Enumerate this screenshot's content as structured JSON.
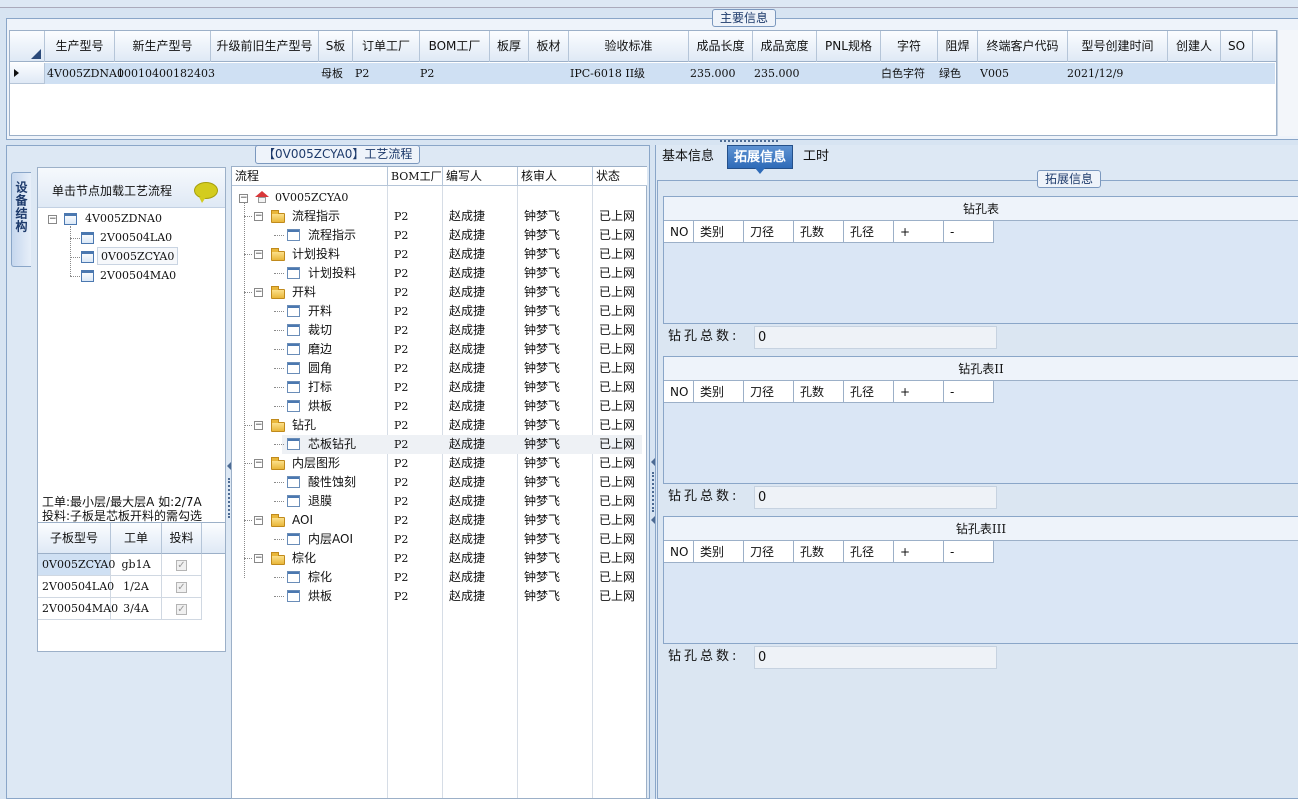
{
  "main_info": {
    "title": "主要信息",
    "columns": [
      "生产型号",
      "新生产型号",
      "升级前旧生产型号",
      "S板",
      "订单工厂",
      "BOM工厂",
      "板厚",
      "板材",
      "验收标准",
      "成品长度",
      "成品宽度",
      "PNL规格",
      "字符",
      "阻焊",
      "终端客户代码",
      "型号创建时间",
      "创建人",
      "SO"
    ],
    "row": {
      "prod_model": "4V005ZDNA0",
      "new_model": "10010400182403",
      "old_model": "",
      "s_board": "母板",
      "order_factory": "P2",
      "bom_factory": "P2",
      "thickness": "",
      "material": "",
      "standard": "IPC-6018 II级",
      "length": "235.000",
      "width": "235.000",
      "pnl": "",
      "char": "白色字符",
      "mask": "绿色",
      "customer": "V005",
      "created": "2021/12/9",
      "creator": "",
      "so": ""
    }
  },
  "left": {
    "vtab_label": "设备结构",
    "tree_hint": "单击节点加载工艺流程",
    "tree": {
      "root": "4V005ZDNA0",
      "children": [
        "2V00504LA0",
        "0V005ZCYA0",
        "2V00504MA0"
      ]
    },
    "note1": "工单:最小层/最大层A 如:2/7A",
    "note2": "投料:子板是芯板开料的需勾选",
    "sub_grid": {
      "columns": [
        "子板型号",
        "工单",
        "投料"
      ],
      "rows": [
        {
          "model": "0V005ZCYA0",
          "order": "gb1A"
        },
        {
          "model": "2V00504LA0",
          "order": "1/2A"
        },
        {
          "model": "2V00504MA0",
          "order": "3/4A"
        }
      ]
    }
  },
  "process": {
    "title": "【0V005ZCYA0】工艺流程",
    "columns": [
      "流程",
      "BOM工厂",
      "编写人",
      "核审人",
      "状态"
    ],
    "root": "0V005ZCYA0",
    "rows": [
      {
        "name": "流程指示",
        "level": 1,
        "folder": true,
        "bom": "P2",
        "writer": "赵成捷",
        "reviewer": "钟梦飞",
        "status": "已上网"
      },
      {
        "name": "流程指示",
        "level": 2,
        "folder": false,
        "bom": "P2",
        "writer": "赵成捷",
        "reviewer": "钟梦飞",
        "status": "已上网"
      },
      {
        "name": "计划投料",
        "level": 1,
        "folder": true,
        "bom": "P2",
        "writer": "赵成捷",
        "reviewer": "钟梦飞",
        "status": "已上网"
      },
      {
        "name": "计划投料",
        "level": 2,
        "folder": false,
        "bom": "P2",
        "writer": "赵成捷",
        "reviewer": "钟梦飞",
        "status": "已上网"
      },
      {
        "name": "开料",
        "level": 1,
        "folder": true,
        "bom": "P2",
        "writer": "赵成捷",
        "reviewer": "钟梦飞",
        "status": "已上网"
      },
      {
        "name": "开料",
        "level": 2,
        "folder": false,
        "bom": "P2",
        "writer": "赵成捷",
        "reviewer": "钟梦飞",
        "status": "已上网"
      },
      {
        "name": "裁切",
        "level": 2,
        "folder": false,
        "bom": "P2",
        "writer": "赵成捷",
        "reviewer": "钟梦飞",
        "status": "已上网"
      },
      {
        "name": "磨边",
        "level": 2,
        "folder": false,
        "bom": "P2",
        "writer": "赵成捷",
        "reviewer": "钟梦飞",
        "status": "已上网"
      },
      {
        "name": "圆角",
        "level": 2,
        "folder": false,
        "bom": "P2",
        "writer": "赵成捷",
        "reviewer": "钟梦飞",
        "status": "已上网"
      },
      {
        "name": "打标",
        "level": 2,
        "folder": false,
        "bom": "P2",
        "writer": "赵成捷",
        "reviewer": "钟梦飞",
        "status": "已上网"
      },
      {
        "name": "烘板",
        "level": 2,
        "folder": false,
        "bom": "P2",
        "writer": "赵成捷",
        "reviewer": "钟梦飞",
        "status": "已上网"
      },
      {
        "name": "钻孔",
        "level": 1,
        "folder": true,
        "bom": "P2",
        "writer": "赵成捷",
        "reviewer": "钟梦飞",
        "status": "已上网"
      },
      {
        "name": "芯板钻孔",
        "level": 2,
        "folder": false,
        "bom": "P2",
        "writer": "赵成捷",
        "reviewer": "钟梦飞",
        "status": "已上网"
      },
      {
        "name": "内层图形",
        "level": 1,
        "folder": true,
        "bom": "P2",
        "writer": "赵成捷",
        "reviewer": "钟梦飞",
        "status": "已上网"
      },
      {
        "name": "酸性蚀刻",
        "level": 2,
        "folder": false,
        "bom": "P2",
        "writer": "赵成捷",
        "reviewer": "钟梦飞",
        "status": "已上网"
      },
      {
        "name": "退膜",
        "level": 2,
        "folder": false,
        "bom": "P2",
        "writer": "赵成捷",
        "reviewer": "钟梦飞",
        "status": "已上网"
      },
      {
        "name": "AOI",
        "level": 1,
        "folder": true,
        "bom": "P2",
        "writer": "赵成捷",
        "reviewer": "钟梦飞",
        "status": "已上网"
      },
      {
        "name": "内层AOI",
        "level": 2,
        "folder": false,
        "bom": "P2",
        "writer": "赵成捷",
        "reviewer": "钟梦飞",
        "status": "已上网"
      },
      {
        "name": "棕化",
        "level": 1,
        "folder": true,
        "bom": "P2",
        "writer": "赵成捷",
        "reviewer": "钟梦飞",
        "status": "已上网"
      },
      {
        "name": "棕化",
        "level": 2,
        "folder": false,
        "bom": "P2",
        "writer": "赵成捷",
        "reviewer": "钟梦飞",
        "status": "已上网"
      },
      {
        "name": "烘板",
        "level": 2,
        "folder": false,
        "bom": "P2",
        "writer": "赵成捷",
        "reviewer": "钟梦飞",
        "status": "已上网"
      }
    ]
  },
  "right": {
    "tabs": [
      "基本信息",
      "拓展信息",
      "工时"
    ],
    "active_tab": "拓展信息",
    "group_title": "拓展信息",
    "drill_columns": [
      "NO",
      "类别",
      "刀径",
      "孔数",
      "孔径",
      "+",
      "-"
    ],
    "tables": [
      {
        "title": "钻孔表",
        "total_label": "钻孔总数:",
        "total": "0"
      },
      {
        "title": "钻孔表II",
        "total_label": "钻孔总数:",
        "total": "0"
      },
      {
        "title": "钻孔表III",
        "total_label": "钻孔总数:",
        "total": "0"
      }
    ]
  },
  "colors": {
    "selected_row": "#cfe0f3",
    "active_tab": "#2f6bb8",
    "panel_bg": "#dde8f4"
  }
}
